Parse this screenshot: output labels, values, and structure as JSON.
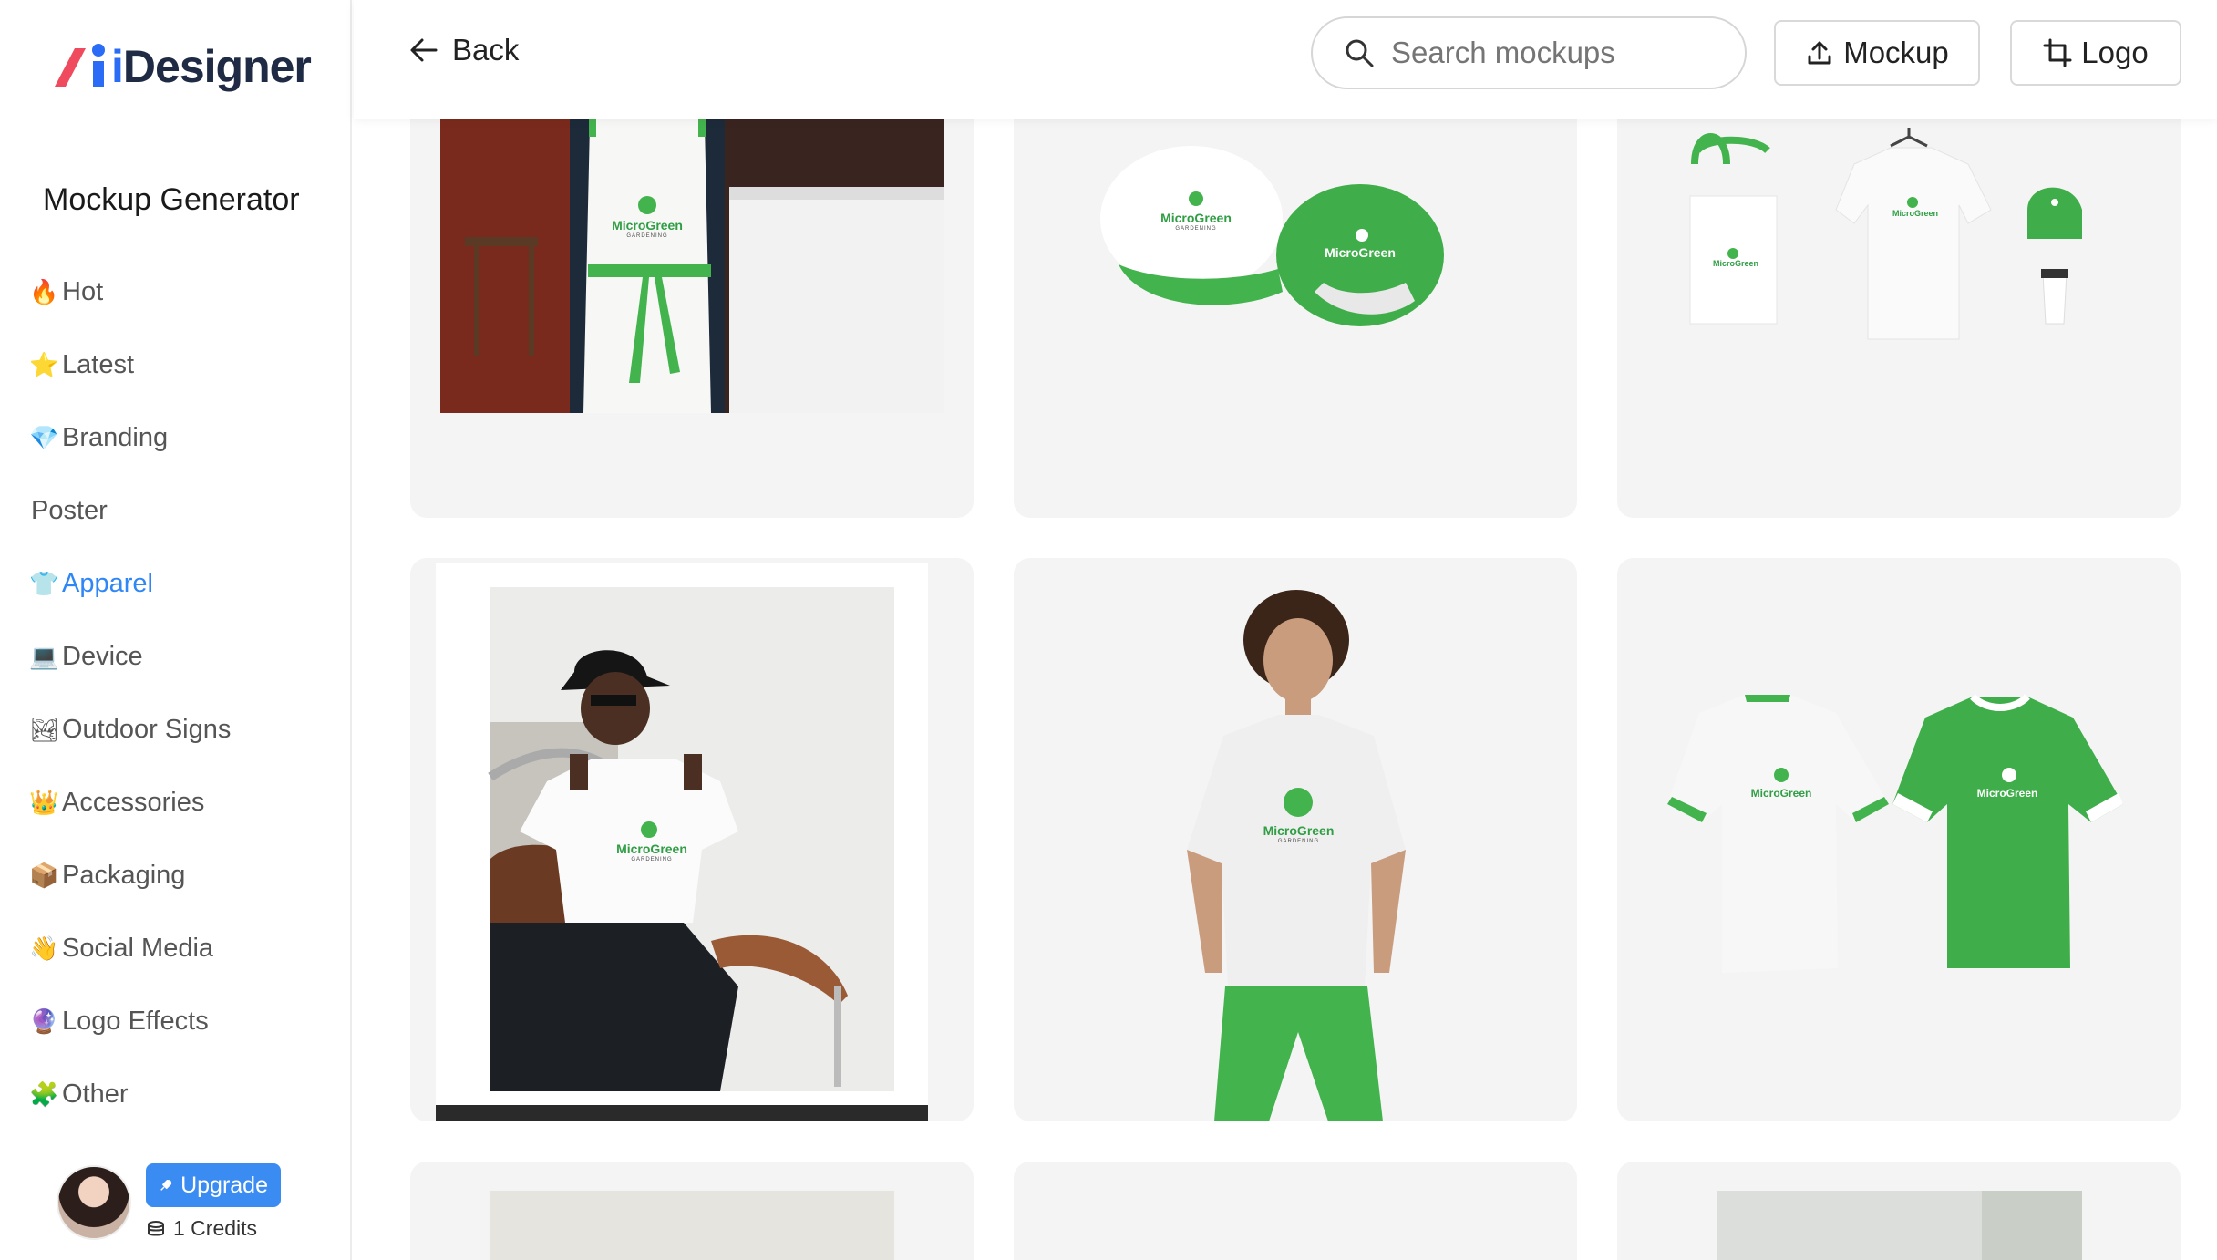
{
  "brand": {
    "logo_text_prefix": "i",
    "logo_text": "Designer"
  },
  "sidebar": {
    "title": "Mockup Generator",
    "items": [
      {
        "emoji": "🔥",
        "label": "Hot"
      },
      {
        "emoji": "⭐",
        "label": "Latest"
      },
      {
        "emoji": "💎",
        "label": "Branding"
      },
      {
        "emoji": "",
        "label": "Poster"
      },
      {
        "emoji": "👕",
        "label": "Apparel",
        "active": true
      },
      {
        "emoji": "💻",
        "label": "Device"
      },
      {
        "emoji": "🏞",
        "label": "Outdoor Signs"
      },
      {
        "emoji": "👑",
        "label": "Accessories"
      },
      {
        "emoji": "📦",
        "label": "Packaging"
      },
      {
        "emoji": "👋",
        "label": "Social Media"
      },
      {
        "emoji": "🔮",
        "label": "Logo Effects"
      },
      {
        "emoji": "🧩",
        "label": "Other"
      }
    ],
    "user": {
      "upgrade_label": "Upgrade",
      "credits_label": "1 Credits"
    }
  },
  "header": {
    "back_label": "Back",
    "search_placeholder": "Search mockups",
    "mockup_button": "Mockup",
    "logo_button": "Logo"
  },
  "mockup_brand": {
    "name": "MicroGreen",
    "sub": "GARDENING"
  },
  "colors": {
    "accent_blue": "#2f86f6",
    "brand_green": "#43b34d",
    "card_bg": "#f4f4f4"
  }
}
